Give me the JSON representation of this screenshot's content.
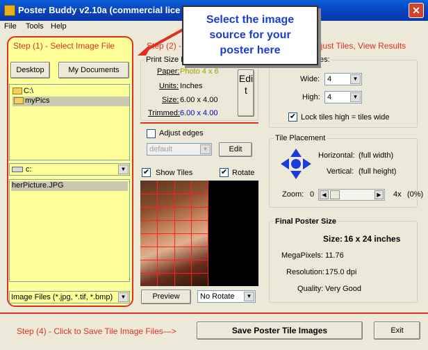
{
  "window": {
    "title": "Poster Buddy v2.10a (commercial lice",
    "close_glyph": "✕"
  },
  "menu": [
    "File",
    "Tools",
    "Help"
  ],
  "callout": {
    "line1": "Select the image",
    "line2": "source for your",
    "line3": "poster here"
  },
  "step1": {
    "label": "Step (1) - Select Image File",
    "desktop_button": "Desktop",
    "my_documents_button": "My Documents",
    "folders": [
      "C:\\",
      "myPics"
    ],
    "drive": "c:",
    "files": [
      "herPicture.JPG"
    ],
    "filter": "Image Files (*.jpg, *.tif, *.bmp)"
  },
  "step2": {
    "label": "Step (2) -",
    "print_size_title": "Print Size I",
    "paper_label": "Paper:",
    "paper_value": "Photo 4 x 6",
    "units_label": "Units:",
    "units_value": "Inches",
    "size_label": "Size:",
    "size_value": "6.00 x 4.00",
    "trimmed_label": "Trimmed:",
    "trimmed_value": "6.00 x 4.00",
    "edit_vertical": "Edit",
    "adjust_edges_label": "Adjust edges",
    "edges_default": "default",
    "edit_button": "Edit",
    "show_tiles_label": "Show Tiles",
    "rotate_label": "Rotate",
    "preview_button": "Preview",
    "rotate_option": "No Rotate"
  },
  "step3": {
    "label": "djust Tiles, View Results",
    "tiles_group_title": "es:",
    "wide_label": "Wide:",
    "wide_value": "4",
    "high_label": "High:",
    "high_value": "4",
    "lock_label": "Lock tiles high = tiles wide",
    "placement_title": "Tile Placement",
    "horizontal_label": "Horizontal:",
    "horizontal_value": "(full width)",
    "vertical_label": "Vertical:",
    "vertical_value": "(full height)",
    "zoom_label": "Zoom:",
    "zoom_min": "0",
    "zoom_max": "4x",
    "zoom_pct": "(0%)",
    "zoom_level": 0.0
  },
  "final": {
    "title": "Final Poster Size",
    "size_label": "Size:",
    "size_value": "16 x 24 inches",
    "megapixels_label": "MegaPixels:",
    "megapixels_value": "11.76",
    "resolution_label": "Resolution:",
    "resolution_value": "175.0 dpi",
    "quality_label": "Quality:",
    "quality_value": "Very Good"
  },
  "step4": {
    "label": "Step (4) - Click to Save Tile Image Files—>",
    "save_button": "Save Poster Tile Images",
    "exit_button": "Exit"
  },
  "colors": {
    "accent_red": "#e03020",
    "panel_yellow": "#ffff99",
    "title_blue": "#0a5fd8",
    "callout_blue": "#1a3cd8",
    "value_blue": "#0000cc"
  }
}
